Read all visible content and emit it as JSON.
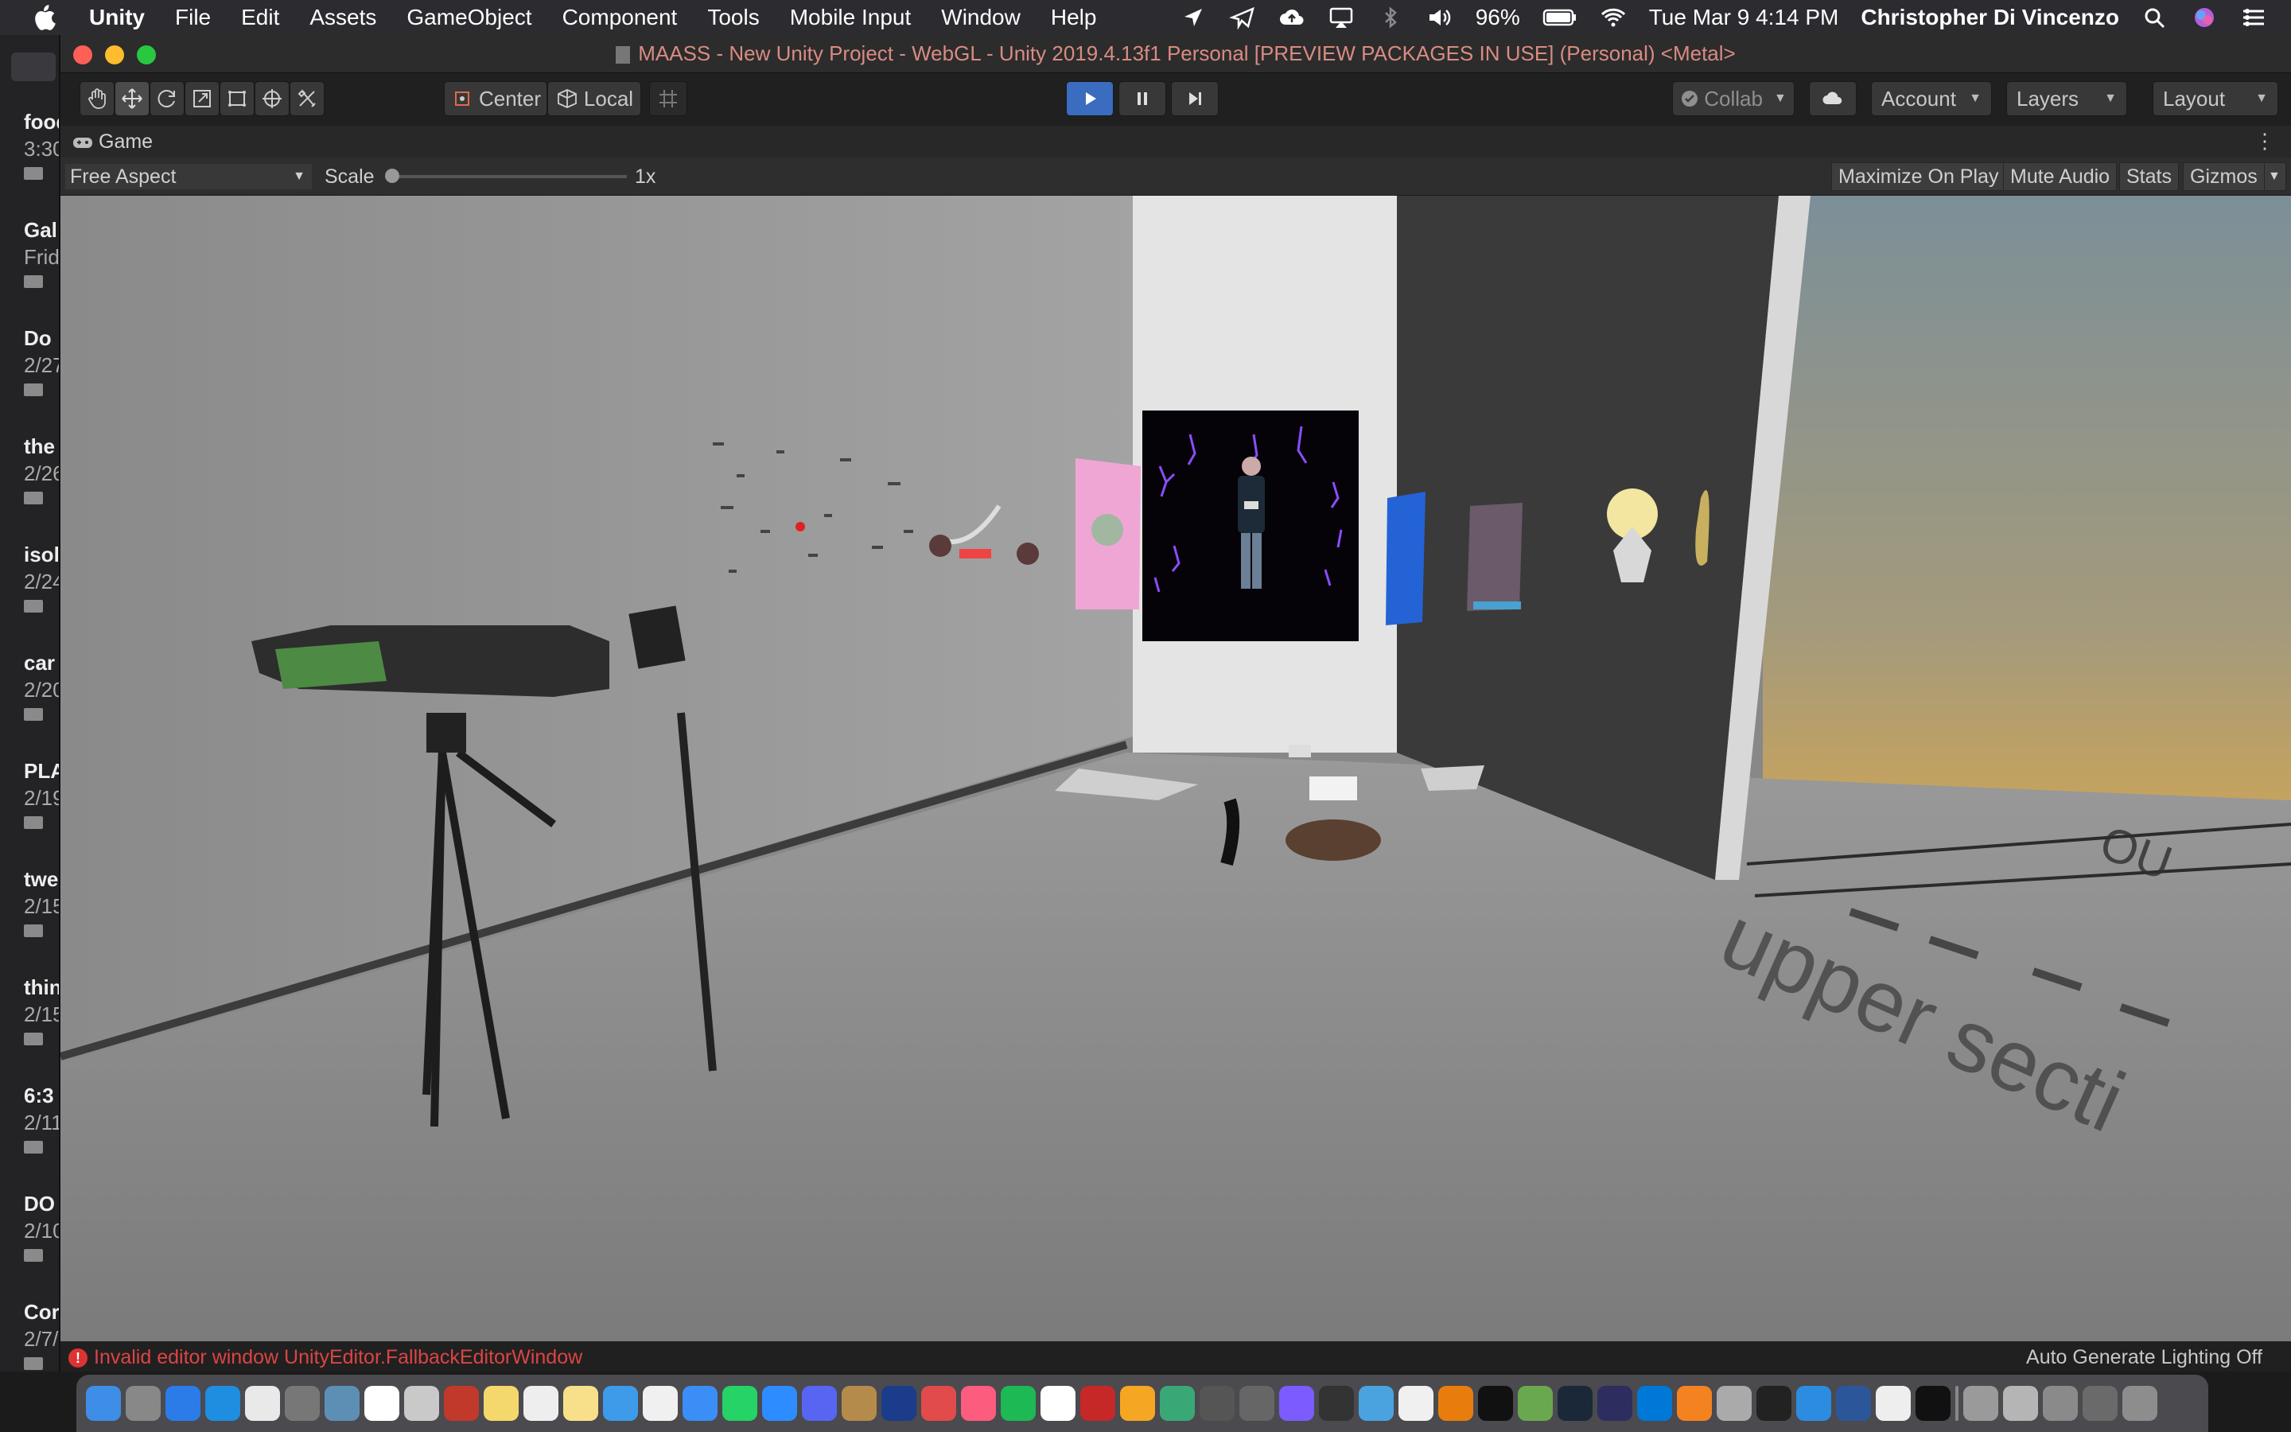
{
  "menubar": {
    "app_name": "Unity",
    "items": [
      "File",
      "Edit",
      "Assets",
      "GameObject",
      "Component",
      "Tools",
      "Mobile Input",
      "Window",
      "Help"
    ],
    "battery": "96%",
    "datetime": "Tue Mar 9  4:14 PM",
    "user": "Christopher Di Vincenzo"
  },
  "notes": [
    {
      "title": "food",
      "date": "3:30"
    },
    {
      "title": "Gal",
      "date": "Frid"
    },
    {
      "title": "Do",
      "date": "2/27"
    },
    {
      "title": "the",
      "date": "2/26"
    },
    {
      "title": "isol",
      "date": "2/24"
    },
    {
      "title": "car",
      "date": "2/20"
    },
    {
      "title": "PLA",
      "date": "2/19"
    },
    {
      "title": "twe",
      "date": "2/15"
    },
    {
      "title": "thin",
      "date": "2/15"
    },
    {
      "title": "6:3",
      "date": "2/11"
    },
    {
      "title": "DO",
      "date": "2/10"
    },
    {
      "title": "Cor",
      "date": "2/7/"
    }
  ],
  "window": {
    "title": "MAASS - New Unity Project - WebGL - Unity 2019.4.13f1 Personal [PREVIEW PACKAGES IN USE] (Personal) <Metal>"
  },
  "toolbar": {
    "pivot_label": "Center",
    "space_label": "Local",
    "collab_label": "Collab",
    "account_label": "Account",
    "layers_label": "Layers",
    "layout_label": "Layout"
  },
  "game_view": {
    "tab_label": "Game",
    "aspect": "Free Aspect",
    "scale_label": "Scale",
    "scale_value": "1x",
    "maximize_label": "Maximize On Play",
    "mute_label": "Mute Audio",
    "stats_label": "Stats",
    "gizmos_label": "Gizmos",
    "floor_text": "upper secti",
    "floor_text_far": "OU"
  },
  "status": {
    "error": "Invalid editor window UnityEditor.FallbackEditorWindow",
    "lighting": "Auto Generate Lighting Off"
  },
  "colors": {
    "accent_play": "#3a6cc0",
    "error": "#dd4444",
    "title_text": "#d98b83"
  }
}
